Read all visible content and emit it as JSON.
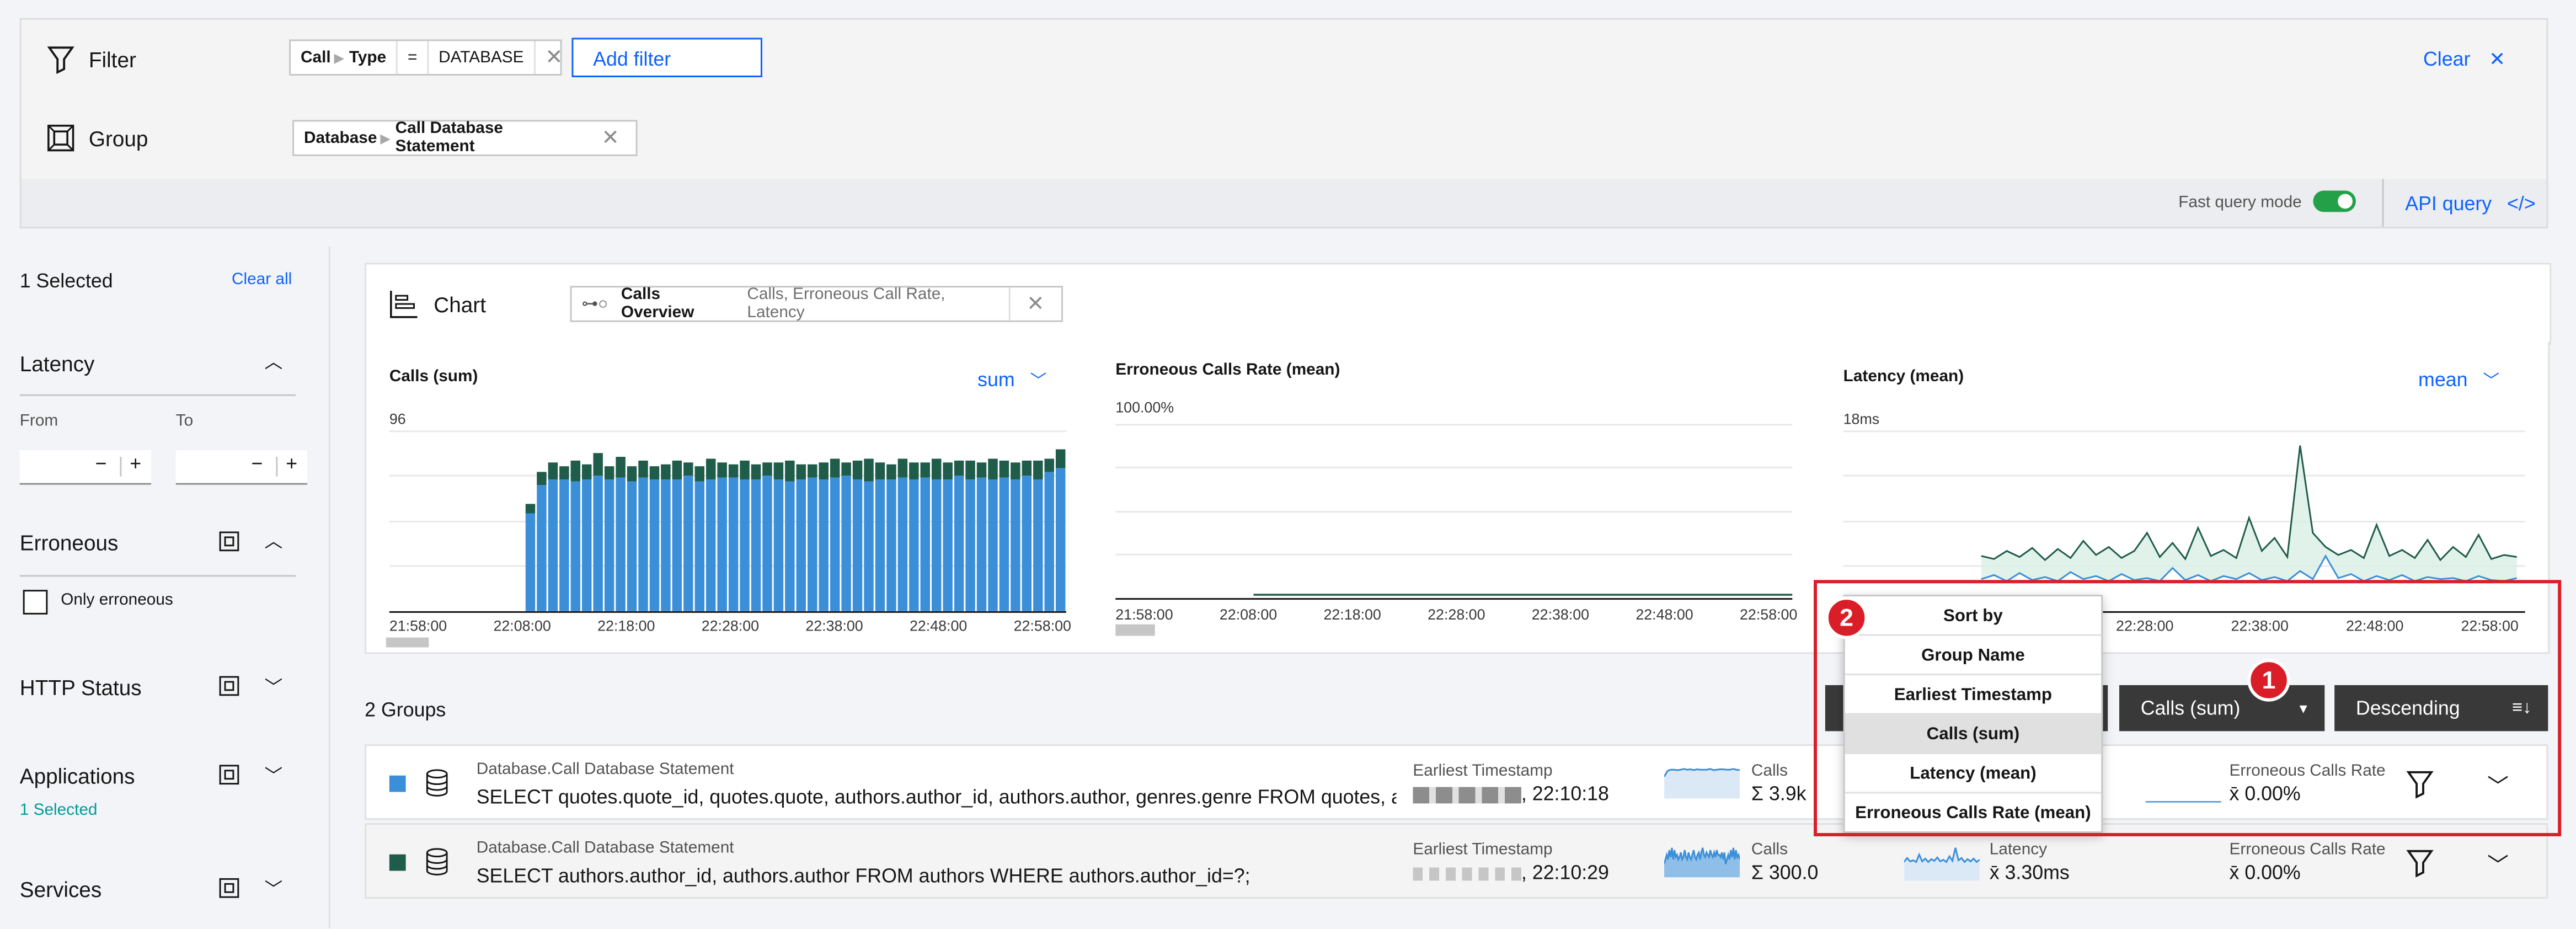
{
  "filter_bar": {
    "label": "Filter",
    "chip": {
      "field_a": "Call",
      "field_b": "Type",
      "operator": "=",
      "value": "DATABASE"
    },
    "add_filter_label": "Add filter",
    "clear_label": "Clear"
  },
  "group_bar": {
    "label": "Group",
    "chip": {
      "field_a": "Database",
      "field_b": "Call Database Statement"
    }
  },
  "options_bar": {
    "fast_query_label": "Fast query mode",
    "fast_query_on": true,
    "api_query_label": "API query"
  },
  "sidebar": {
    "selected_label": "1 Selected",
    "clear_all_label": "Clear all",
    "latency": {
      "title": "Latency",
      "from_label": "From",
      "to_label": "To",
      "minus": "−",
      "plus": "+"
    },
    "erroneous": {
      "title": "Erroneous",
      "only_label": "Only erroneous"
    },
    "http_status": {
      "title": "HTTP Status"
    },
    "applications": {
      "title": "Applications",
      "selected": "1 Selected"
    },
    "services": {
      "title": "Services"
    }
  },
  "chart_section": {
    "label": "Chart",
    "preset_name": "Calls Overview",
    "preset_metrics": "Calls, Erroneous Call Rate, Latency"
  },
  "colors": {
    "blue_series": "#3b8fd9",
    "green_series": "#1f5c4a",
    "accent": "#0f62fe",
    "annotation_red": "#da1e28"
  },
  "chart_data": [
    {
      "type": "bar",
      "title": "Calls (sum)",
      "aggregation_label": "sum",
      "ymax_label": "96",
      "ylim": [
        0,
        96
      ],
      "x_ticks": [
        "21:58:00",
        "22:08:00",
        "22:18:00",
        "22:28:00",
        "22:38:00",
        "22:48:00",
        "22:58:00"
      ],
      "series": [
        {
          "values": [
            52,
            67,
            70,
            70,
            69,
            70,
            72,
            70,
            71,
            69,
            71,
            70,
            70,
            70,
            72,
            69,
            70,
            71,
            71,
            70,
            70,
            72,
            70,
            69,
            70,
            71,
            70,
            71,
            72,
            70,
            69,
            70,
            70,
            71,
            70,
            71,
            70,
            70,
            72,
            70,
            71,
            70,
            71,
            70,
            72,
            70,
            74,
            76
          ]
        },
        {
          "values": [
            5,
            7,
            9,
            7,
            11,
            8,
            12,
            7,
            11,
            8,
            9,
            7,
            8,
            10,
            7,
            8,
            11,
            8,
            7,
            10,
            8,
            7,
            9,
            11,
            8,
            7,
            9,
            10,
            7,
            10,
            12,
            9,
            8,
            10,
            9,
            8,
            11,
            9,
            8,
            10,
            8,
            11,
            9,
            9,
            8,
            10,
            7,
            10
          ]
        }
      ]
    },
    {
      "type": "line",
      "title": "Erroneous Calls Rate (mean)",
      "ymax_label": "100.00%",
      "ylim": [
        0,
        100
      ],
      "x_ticks": [
        "21:58:00",
        "22:08:00",
        "22:18:00",
        "22:28:00",
        "22:38:00",
        "22:48:00",
        "22:58:00"
      ],
      "series": [
        {
          "values": [
            0,
            0,
            0,
            0,
            0,
            0,
            0,
            0,
            0,
            0,
            0,
            0,
            0,
            0,
            0,
            0
          ]
        }
      ]
    },
    {
      "type": "area",
      "title": "Latency (mean)",
      "aggregation_label": "mean",
      "ymax_label": "18ms",
      "ylim": [
        0,
        18
      ],
      "x_ticks": [
        "22:28:00",
        "22:38:00",
        "22:48:00",
        "22:58:00"
      ],
      "series": [
        {
          "values": [
            5.5,
            5.2,
            6.0,
            5.4,
            6.3,
            5.1,
            6.2,
            5.3,
            7.0,
            5.6,
            6.4,
            5.3,
            6.0,
            7.8,
            5.4,
            6.8,
            5.2,
            8.3,
            5.5,
            6.1,
            5.3,
            9.3,
            6.0,
            7.3,
            5.4,
            16.5,
            7.8,
            6.4,
            5.6,
            6.1,
            5.3,
            8.6,
            5.5,
            6.1,
            5.3,
            7.1,
            5.1,
            6.4,
            5.4,
            7.6,
            5.2,
            5.6,
            5.4
          ]
        },
        {
          "values": [
            3.2,
            3.6,
            3.0,
            3.8,
            3.1,
            3.4,
            3.0,
            3.9,
            3.2,
            3.5,
            3.0,
            3.7,
            3.1,
            3.3,
            3.0,
            4.3,
            3.1,
            3.6,
            3.0,
            3.5,
            3.2,
            3.8,
            3.1,
            3.4,
            3.0,
            4.0,
            3.2,
            5.5,
            3.3,
            3.7,
            3.0,
            3.5,
            3.1,
            3.6,
            3.0,
            3.4,
            3.2,
            3.3,
            3.0,
            3.5,
            3.1,
            3.0,
            3.3
          ]
        }
      ]
    }
  ],
  "groups": {
    "count_label": "2 Groups",
    "sort_field_label": "Calls (sum)",
    "order_label": "Descending",
    "sort_menu": {
      "header": "Sort by",
      "options": [
        "Group Name",
        "Earliest Timestamp",
        "Calls (sum)",
        "Latency (mean)",
        "Erroneous Calls Rate (mean)"
      ],
      "selected": "Calls (sum)"
    },
    "rows": [
      {
        "group_name": "Database.Call Database Statement",
        "statement": "SELECT quotes.quote_id, quotes.quote, authors.author_id, authors.author, genres.genre FROM quotes, au",
        "earliest_label": "Earliest Timestamp",
        "earliest_time": ", 22:10:18",
        "calls_label": "Calls",
        "calls_value": "Σ 3.9k",
        "err_label": "Erroneous Calls Rate",
        "err_value": "x̄ 0.00%"
      },
      {
        "group_name": "Database.Call Database Statement",
        "statement": "SELECT authors.author_id, authors.author FROM authors WHERE authors.author_id=?;",
        "earliest_label": "Earliest Timestamp",
        "earliest_time": ", 22:10:29",
        "calls_label": "Calls",
        "calls_value": "Σ 300.0",
        "latency_label": "Latency",
        "latency_value": "x̄ 3.30ms",
        "err_label": "Erroneous Calls Rate",
        "err_value": "x̄ 0.00%"
      }
    ]
  },
  "annotations": [
    "1",
    "2"
  ]
}
